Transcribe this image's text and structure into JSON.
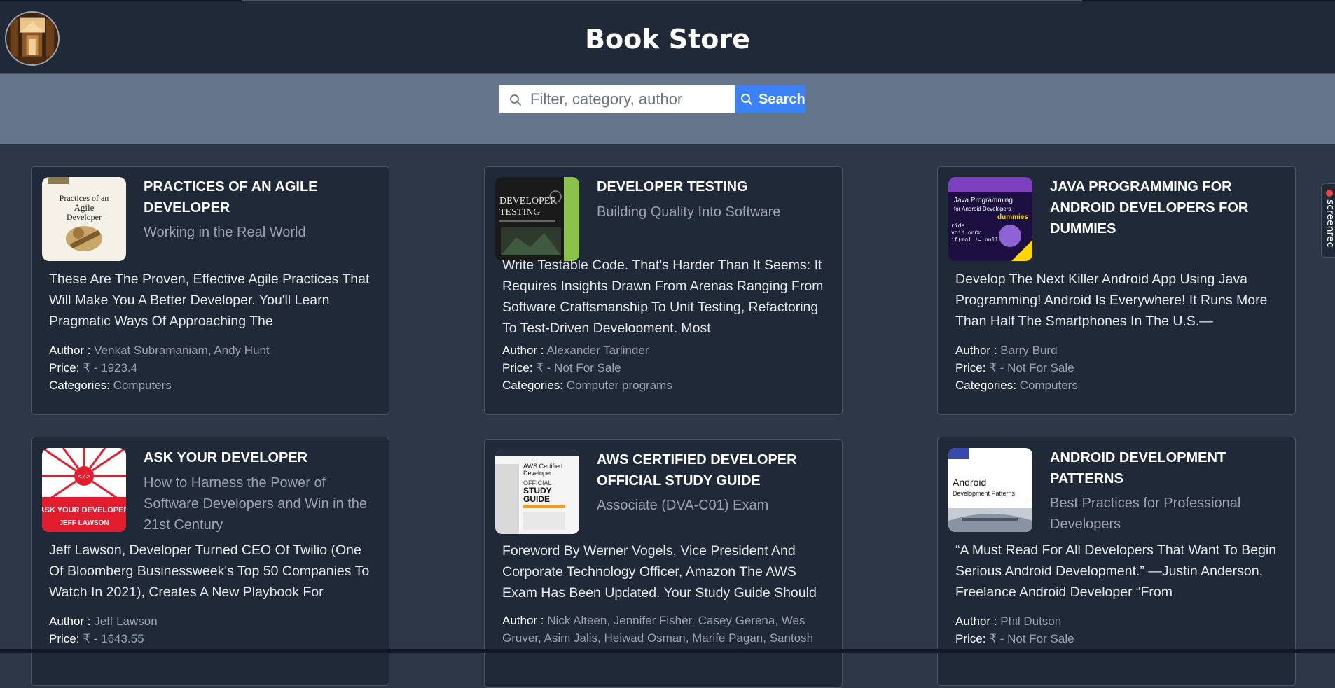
{
  "header": {
    "title": "Book Store"
  },
  "search": {
    "placeholder": "Filter, category, author",
    "value": "",
    "button_label": "Search"
  },
  "side_widget": {
    "label": "screenrec"
  },
  "labels": {
    "author": "Author :",
    "price": "Price:",
    "categories": "Categories:"
  },
  "books": [
    {
      "title": "PRACTICES OF AN AGILE DEVELOPER",
      "subtitle": "Working in the Real World",
      "description": "These Are The Proven, Effective Agile Practices That Will Make You A Better Developer. You'll Learn Pragmatic Ways Of Approaching The",
      "author": "Venkat Subramaniam, Andy Hunt",
      "price": "₹ - 1923.4",
      "categories": "Computers",
      "cover_icon": "agile-developer-cover"
    },
    {
      "title": "DEVELOPER TESTING",
      "subtitle": "Building Quality Into Software",
      "description": "Write Testable Code. That's Harder Than It Seems: It Requires Insights Drawn From Arenas Ranging From Software Craftsmanship To Unit Testing, Refactoring To Test-Driven Development. Most",
      "author": "Alexander Tarlinder",
      "price": "₹ - Not For Sale",
      "categories": "Computer programs",
      "cover_icon": "developer-testing-cover"
    },
    {
      "title": "JAVA PROGRAMMING FOR ANDROID DEVELOPERS FOR DUMMIES",
      "subtitle": "",
      "description": "Develop The Next Killer Android App Using Java Programming! Android Is Everywhere! It Runs More Than Half The Smartphones In The U.S.—",
      "author": "Barry Burd",
      "price": "₹ - Not For Sale",
      "categories": "Computers",
      "cover_icon": "java-dummies-cover"
    },
    {
      "title": "ASK YOUR DEVELOPER",
      "subtitle": "How to Harness the Power of Software Developers and Win in the 21st Century",
      "description": "Jeff Lawson, Developer Turned CEO Of Twilio (One Of Bloomberg Businessweek's Top 50 Companies To Watch In 2021), Creates A New Playbook For",
      "author": "Jeff Lawson",
      "price": "₹ - 1643.55",
      "categories": "",
      "cover_icon": "ask-your-developer-cover"
    },
    {
      "title": "AWS CERTIFIED DEVELOPER OFFICIAL STUDY GUIDE",
      "subtitle": "Associate (DVA-C01) Exam",
      "description": "Foreword By Werner Vogels, Vice President And Corporate Technology Officer, Amazon The AWS Exam Has Been Updated. Your Study Guide Should",
      "author": "Nick Alteen, Jennifer Fisher, Casey Gerena, Wes Gruver, Asim Jalis, Heiwad Osman, Marife Pagan, Santosh",
      "price": "",
      "categories": "",
      "cover_icon": "aws-study-guide-cover"
    },
    {
      "title": "ANDROID DEVELOPMENT PATTERNS",
      "subtitle": "Best Practices for Professional Developers",
      "description": "“A Must Read For All Developers That Want To Begin Serious Android Development.” —Justin Anderson, Freelance Android Developer “From",
      "author": "Phil Dutson",
      "price": "₹ - Not For Sale",
      "categories": "",
      "cover_icon": "android-patterns-cover"
    }
  ]
}
